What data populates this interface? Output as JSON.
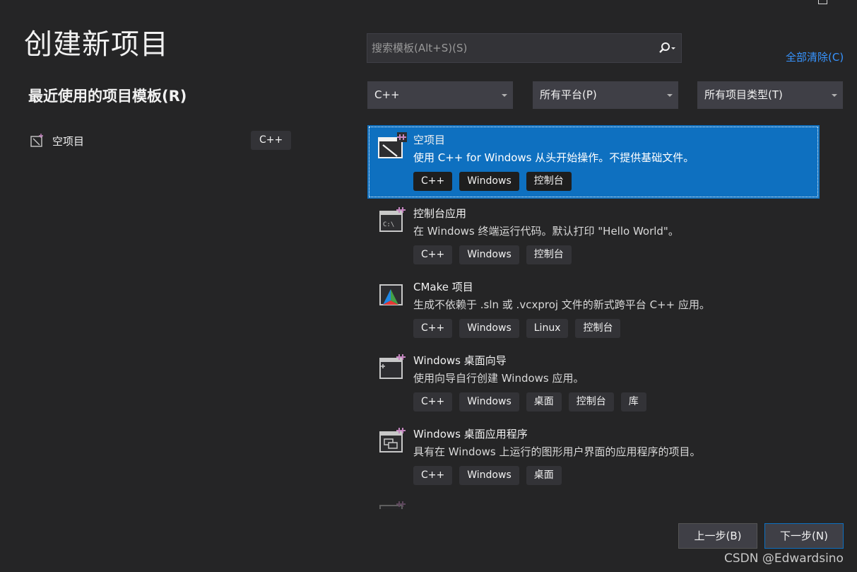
{
  "page": {
    "title": "创建新项目"
  },
  "recent": {
    "title": "最近使用的项目模板(R)",
    "items": [
      {
        "label": "空项目",
        "tag": "C++",
        "icon": "empty-project-icon"
      }
    ]
  },
  "search": {
    "placeholder": "搜索模板(Alt+S)(S)",
    "icon": "search-icon"
  },
  "clear_all": "全部清除(C)",
  "filters": {
    "language": "C++",
    "platform": "所有平台(P)",
    "project_type": "所有项目类型(T)"
  },
  "templates": [
    {
      "name": "空项目",
      "description": "使用 C++ for Windows 从头开始操作。不提供基础文件。",
      "tags": [
        "C++",
        "Windows",
        "控制台"
      ],
      "icon": "empty-project-icon",
      "selected": true
    },
    {
      "name": "控制台应用",
      "description": "在 Windows 终端运行代码。默认打印 \"Hello World\"。",
      "tags": [
        "C++",
        "Windows",
        "控制台"
      ],
      "icon": "console-app-icon"
    },
    {
      "name": "CMake 项目",
      "description": "生成不依赖于 .sln 或 .vcxproj 文件的新式跨平台 C++ 应用。",
      "tags": [
        "C++",
        "Windows",
        "Linux",
        "控制台"
      ],
      "icon": "cmake-icon"
    },
    {
      "name": "Windows 桌面向导",
      "description": "使用向导自行创建 Windows 应用。",
      "tags": [
        "C++",
        "Windows",
        "桌面",
        "控制台",
        "库"
      ],
      "icon": "desktop-wizard-icon"
    },
    {
      "name": "Windows 桌面应用程序",
      "description": "具有在 Windows 上运行的图形用户界面的应用程序的项目。",
      "tags": [
        "C++",
        "Windows",
        "桌面"
      ],
      "icon": "desktop-app-icon"
    }
  ],
  "buttons": {
    "back": "上一步(B)",
    "next": "下一步(N)"
  },
  "watermark": "CSDN @Edwardsino",
  "colors": {
    "background": "#252526",
    "accent": "#0e70c0",
    "link": "#3794ff"
  }
}
